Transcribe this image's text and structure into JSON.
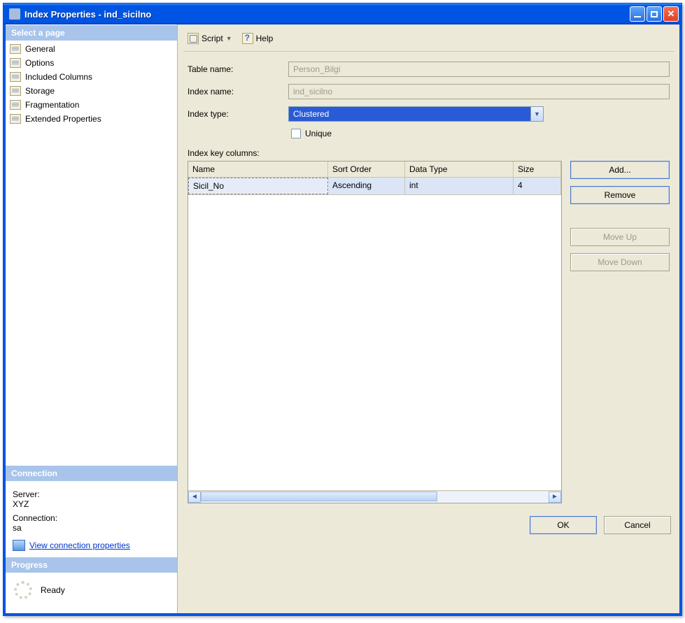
{
  "window": {
    "title": "Index Properties - ind_sicilno"
  },
  "sidebar": {
    "select_header": "Select a page",
    "pages": [
      {
        "label": "General",
        "selected": true
      },
      {
        "label": "Options",
        "selected": false
      },
      {
        "label": "Included Columns",
        "selected": false
      },
      {
        "label": "Storage",
        "selected": false
      },
      {
        "label": "Fragmentation",
        "selected": false
      },
      {
        "label": "Extended Properties",
        "selected": false
      }
    ],
    "connection_header": "Connection",
    "connection": {
      "server_label": "Server:",
      "server_value": "XYZ",
      "conn_label": "Connection:",
      "conn_value": "sa",
      "view_link": "View connection properties"
    },
    "progress_header": "Progress",
    "progress": {
      "status": "Ready"
    }
  },
  "toolbar": {
    "script_label": "Script",
    "help_label": "Help"
  },
  "form": {
    "table_label": "Table name:",
    "table_value": "Person_Bilgi",
    "index_label": "Index name:",
    "index_value": "ind_sicilno",
    "type_label": "Index type:",
    "type_value": "Clustered",
    "unique_label": "Unique",
    "grid_label": "Index key columns:",
    "columns": {
      "name": "Name",
      "sort": "Sort Order",
      "dtype": "Data Type",
      "size": "Size"
    },
    "rows": [
      {
        "name": "Sicil_No",
        "sort": "Ascending",
        "dtype": "int",
        "size": "4"
      }
    ]
  },
  "buttons": {
    "add": "Add...",
    "remove": "Remove",
    "move_up": "Move Up",
    "move_down": "Move Down",
    "ok": "OK",
    "cancel": "Cancel"
  }
}
